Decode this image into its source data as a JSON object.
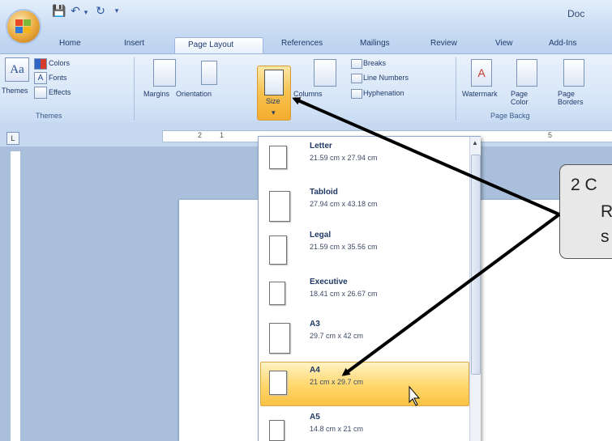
{
  "window": {
    "title": "Doc"
  },
  "tabs": [
    "Home",
    "Insert",
    "Page Layout",
    "References",
    "Mailings",
    "Review",
    "View",
    "Add-Ins"
  ],
  "active_tab": "Page Layout",
  "ribbon": {
    "themes_group": {
      "label": "Themes",
      "themes_button": "Themes",
      "colors": "Colors",
      "fonts": "Fonts",
      "effects": "Effects"
    },
    "page_setup": {
      "margins": "Margins",
      "orientation": "Orientation",
      "size": "Size",
      "columns": "Columns",
      "breaks": "Breaks",
      "line_numbers": "Line Numbers",
      "hyphenation": "Hyphenation"
    },
    "page_background": {
      "label": "Page Backg",
      "watermark": "Watermark",
      "page_color": "Page Color",
      "page_borders": "Page Borders"
    }
  },
  "ruler": {
    "h_marks": [
      "2",
      "1",
      "5"
    ]
  },
  "size_menu": {
    "items": [
      {
        "name": "Letter",
        "dims": "21.59 cm x 27.94 cm"
      },
      {
        "name": "Tabloid",
        "dims": "27.94 cm x 43.18 cm"
      },
      {
        "name": "Legal",
        "dims": "21.59 cm x 35.56 cm"
      },
      {
        "name": "Executive",
        "dims": "18.41 cm x 26.67 cm"
      },
      {
        "name": "A3",
        "dims": "29.7 cm x 42 cm"
      },
      {
        "name": "A4",
        "dims": "21 cm x 29.7 cm",
        "selected": true
      },
      {
        "name": "A5",
        "dims": "14.8 cm x 21 cm"
      }
    ]
  },
  "callout": {
    "lines": [
      "2  C",
      "R",
      "s"
    ]
  },
  "colors": {
    "accent": "#f7c24e",
    "ribbon": "#d6e5f7",
    "workspace": "#a9bfdb"
  }
}
